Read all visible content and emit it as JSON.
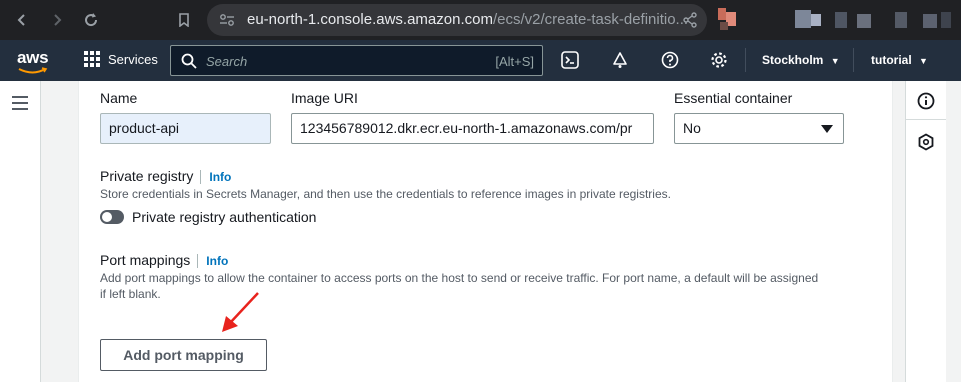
{
  "browser": {
    "url_host": "eu-north-1.console.aws.amazon.com",
    "url_path": "/ecs/v2/create-task-definitio..."
  },
  "aws_nav": {
    "logo_text": "aws",
    "services_label": "Services",
    "search_placeholder": "Search",
    "search_shortcut": "[Alt+S]",
    "region_label": "Stockholm",
    "account_label": "tutorial"
  },
  "form": {
    "name_label": "Name",
    "name_value": "product-api",
    "image_uri_label": "Image URI",
    "image_uri_value": "123456789012.dkr.ecr.eu-north-1.amazonaws.com/pr",
    "essential_label": "Essential container",
    "essential_value": "No",
    "private_registry": {
      "title": "Private registry",
      "info": "Info",
      "description": "Store credentials in Secrets Manager, and then use the credentials to reference images in private registries.",
      "toggle_label": "Private registry authentication"
    },
    "port_mappings": {
      "title": "Port mappings",
      "info": "Info",
      "description_line1": "Add port mappings to allow the container to access ports on the host to send or receive traffic. For port name, a default will be assigned",
      "description_line2": "if left blank.",
      "add_button": "Add port mapping"
    }
  },
  "colors": {
    "aws_nav_bg": "#232f3e",
    "link_blue": "#0073bb",
    "annotation_arrow": "#e8231d"
  }
}
